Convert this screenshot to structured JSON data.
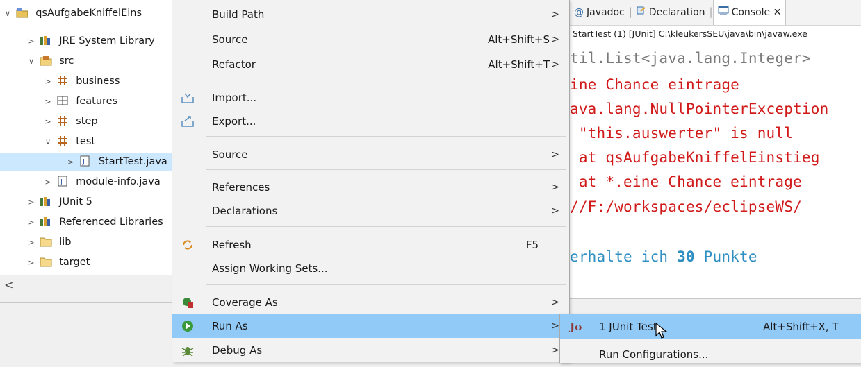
{
  "explorer": {
    "items": [
      {
        "label": "qsAufgabeKniffelEins",
        "twisty": "∨",
        "icon": "project-icon"
      },
      {
        "label": "JRE System Library",
        "twisty": ">",
        "icon": "library-icon"
      },
      {
        "label": "src",
        "twisty": "∨",
        "icon": "source-folder-icon"
      },
      {
        "label": "business",
        "twisty": ">",
        "icon": "package-icon"
      },
      {
        "label": "features",
        "twisty": ">",
        "icon": "empty-package-icon"
      },
      {
        "label": "step",
        "twisty": ">",
        "icon": "package-icon"
      },
      {
        "label": "test",
        "twisty": "∨",
        "icon": "package-icon"
      },
      {
        "label": "StartTest.java",
        "twisty": ">",
        "icon": "java-file-icon"
      },
      {
        "label": "module-info.java",
        "twisty": ">",
        "icon": "java-file-icon"
      },
      {
        "label": "JUnit 5",
        "twisty": ">",
        "icon": "library-icon"
      },
      {
        "label": "Referenced Libraries",
        "twisty": ">",
        "icon": "library-icon"
      },
      {
        "label": "lib",
        "twisty": ">",
        "icon": "folder-icon"
      },
      {
        "label": "target",
        "twisty": ">",
        "icon": "folder-icon"
      }
    ],
    "scroll_left_glyph": "<"
  },
  "context_menu": {
    "items": [
      {
        "label": "Build Path",
        "accel": "",
        "submenu": true
      },
      {
        "label": "Source",
        "accel": "Alt+Shift+S",
        "submenu": true
      },
      {
        "label": "Refactor",
        "accel": "Alt+Shift+T",
        "submenu": true
      },
      {
        "label": "Import...",
        "accel": "",
        "submenu": false,
        "icon": "import-icon"
      },
      {
        "label": "Export...",
        "accel": "",
        "submenu": false,
        "icon": "export-icon"
      },
      {
        "label": "Source",
        "accel": "",
        "submenu": true
      },
      {
        "label": "References",
        "accel": "",
        "submenu": true
      },
      {
        "label": "Declarations",
        "accel": "",
        "submenu": true
      },
      {
        "label": "Refresh",
        "accel": "F5",
        "submenu": false,
        "icon": "refresh-icon"
      },
      {
        "label": "Assign Working Sets...",
        "accel": "",
        "submenu": false
      },
      {
        "label": "Coverage As",
        "accel": "",
        "submenu": true,
        "icon": "coverage-icon"
      },
      {
        "label": "Run As",
        "accel": "",
        "submenu": true,
        "icon": "run-icon"
      },
      {
        "label": "Debug As",
        "accel": "",
        "submenu": true,
        "icon": "debug-icon"
      }
    ],
    "submenu_glyph": ">"
  },
  "tabs": [
    {
      "label": "Javadoc",
      "icon": "@"
    },
    {
      "label": "Declaration",
      "icon": "declaration-icon"
    },
    {
      "label": "Console",
      "icon": "console-icon",
      "close": "✕"
    }
  ],
  "console": {
    "path": "StartTest (1) [JUnit] C:\\kleukersSEU\\java\\bin\\javaw.exe",
    "lines": [
      "til.List<java.lang.Integer>",
      "ine Chance eintrage",
      "ava.lang.NullPointerException",
      " \"this.auswerter\" is null",
      " at qsAufgabeKniffelEinstieg",
      " at *.eine Chance eintrage",
      "//F:/workspaces/eclipseWS/"
    ],
    "result_prefix": "erhalte ich ",
    "result_number": "30",
    "result_suffix": " Punkte"
  },
  "run_as_submenu": {
    "items": [
      {
        "label": "1 JUnit Test",
        "accel": "Alt+Shift+X, T",
        "icon": "Jʊ"
      },
      {
        "label": "Run Configurations...",
        "accel": ""
      }
    ]
  },
  "colors": {
    "highlight": "#91c9f7",
    "console_error": "#d11a1a",
    "console_info": "#2f8fc2"
  }
}
